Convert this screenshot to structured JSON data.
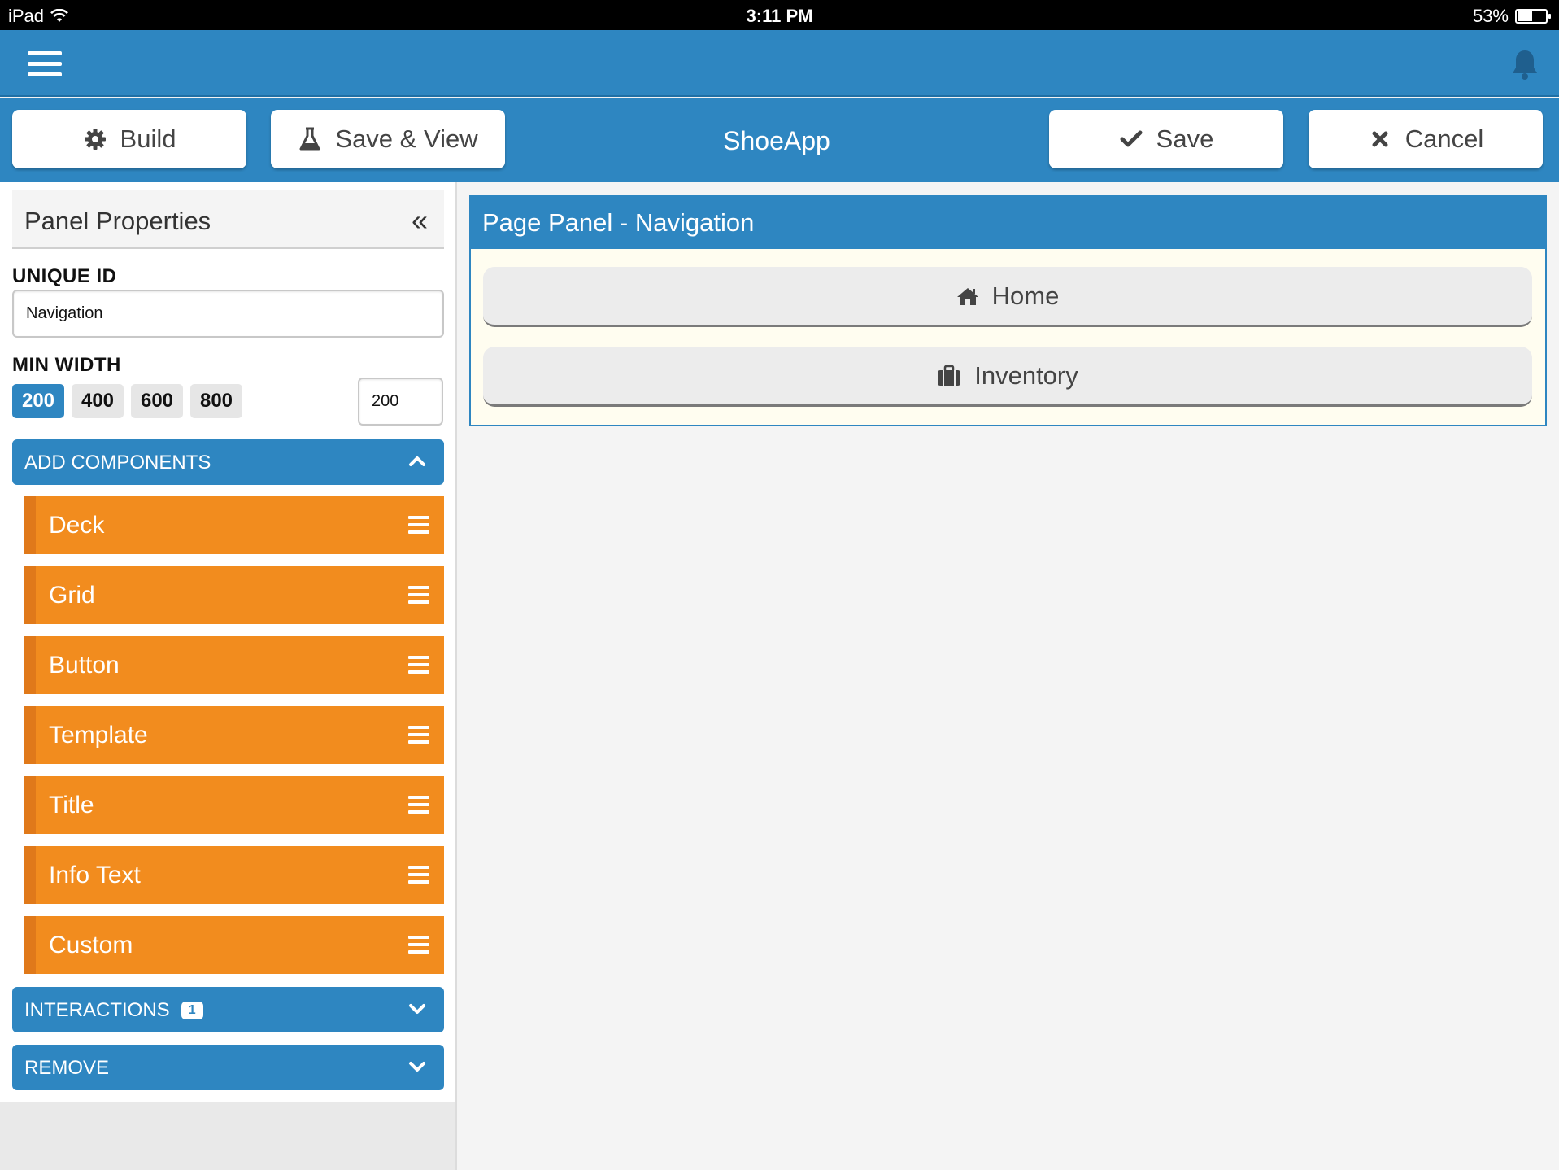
{
  "status_bar": {
    "device": "iPad",
    "time": "3:11 PM",
    "battery": "53%",
    "battery_level": 0.53
  },
  "navbar": {
    "menu_icon": "hamburger-menu-icon",
    "notification_icon": "bell-icon"
  },
  "toolbar": {
    "build_label": "Build",
    "save_view_label": "Save & View",
    "app_title": "ShoeApp",
    "save_label": "Save",
    "cancel_label": "Cancel",
    "icons": [
      "gear-icon",
      "flask-icon",
      "check-icon",
      "x-icon"
    ]
  },
  "panel_properties": {
    "title": "Panel Properties",
    "collapse_glyph": "«",
    "unique_id_label": "UNIQUE ID",
    "unique_id_value": "Navigation",
    "min_width_label": "MIN WIDTH",
    "min_width_options": [
      "200",
      "400",
      "600",
      "800"
    ],
    "min_width_selected": "200",
    "min_width_value": "200"
  },
  "add_components": {
    "label": "ADD COMPONENTS",
    "expanded": true,
    "items": [
      "Deck",
      "Grid",
      "Button",
      "Template",
      "Title",
      "Info Text",
      "Custom"
    ]
  },
  "interactions": {
    "label": "INTERACTIONS",
    "count": "1"
  },
  "remove": {
    "label": "REMOVE"
  },
  "page_panel": {
    "title": "Page Panel - Navigation",
    "buttons": [
      {
        "label": "Home",
        "icon": "home-icon"
      },
      {
        "label": "Inventory",
        "icon": "briefcase-icon"
      }
    ]
  },
  "colors": {
    "primary_blue": "#2e86c1",
    "orange": "#f28c1e",
    "panel_bg": "#fffdf0"
  }
}
